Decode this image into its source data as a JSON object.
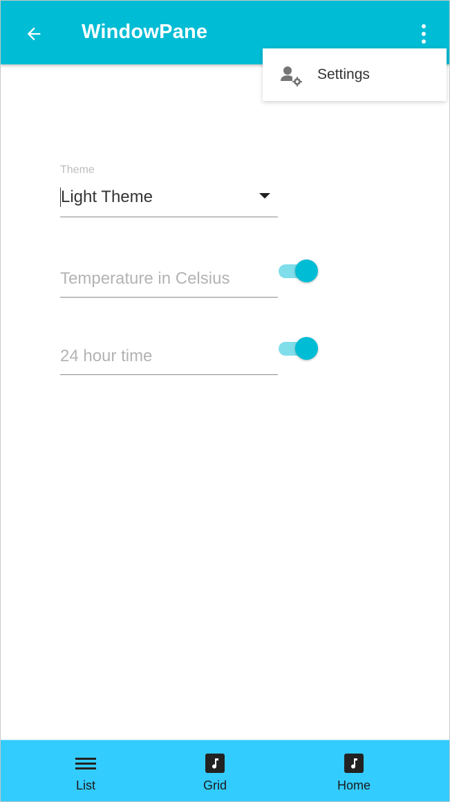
{
  "app": {
    "title": "WindowPane",
    "colors": {
      "primary": "#00BCD4",
      "toggle_track": "#80DEEA",
      "bottom_nav": "#33CCFF"
    }
  },
  "appbar": {
    "back_icon": "arrow-back-icon",
    "more_icon": "more-vert-icon"
  },
  "menu": {
    "items": [
      {
        "label": "Settings",
        "icon": "user-settings-icon"
      }
    ]
  },
  "form": {
    "theme": {
      "label": "Theme",
      "value": "Light Theme",
      "icon": "dropdown-arrow-icon"
    },
    "temperature": {
      "placeholder": "Temperature in Celsius",
      "enabled": true
    },
    "time_format": {
      "placeholder": "24 hour time",
      "enabled": true
    }
  },
  "bottom_nav": {
    "items": [
      {
        "label": "List",
        "icon": "menu-icon"
      },
      {
        "label": "Grid",
        "icon": "music-note-icon"
      },
      {
        "label": "Home",
        "icon": "music-note-icon"
      }
    ]
  }
}
